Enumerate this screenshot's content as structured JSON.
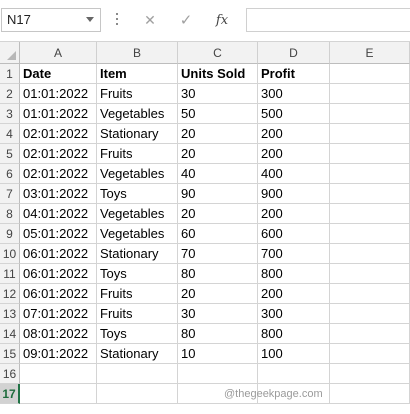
{
  "formula_bar": {
    "name_box": "N17",
    "cancel_glyph": "✕",
    "enter_glyph": "✓",
    "fx_label": "fx",
    "formula": ""
  },
  "columns": [
    "A",
    "B",
    "C",
    "D",
    "E"
  ],
  "rows": [
    "1",
    "2",
    "3",
    "4",
    "5",
    "6",
    "7",
    "8",
    "9",
    "10",
    "11",
    "12",
    "13",
    "14",
    "15",
    "16",
    "17"
  ],
  "active_row": "17",
  "header": [
    "Date",
    "Item",
    "Units Sold",
    "Profit"
  ],
  "data": [
    [
      "01:01:2022",
      "Fruits",
      "30",
      "300"
    ],
    [
      "01:01:2022",
      "Vegetables",
      "50",
      "500"
    ],
    [
      "02:01:2022",
      "Stationary",
      "20",
      "200"
    ],
    [
      "02:01:2022",
      "Fruits",
      "20",
      "200"
    ],
    [
      "02:01:2022",
      "Vegetables",
      "40",
      "400"
    ],
    [
      "03:01:2022",
      "Toys",
      "90",
      "900"
    ],
    [
      "04:01:2022",
      "Vegetables",
      "20",
      "200"
    ],
    [
      "05:01:2022",
      "Vegetables",
      "60",
      "600"
    ],
    [
      "06:01:2022",
      "Stationary",
      "70",
      "700"
    ],
    [
      "06:01:2022",
      "Toys",
      "80",
      "800"
    ],
    [
      "06:01:2022",
      "Fruits",
      "20",
      "200"
    ],
    [
      "07:01:2022",
      "Fruits",
      "30",
      "300"
    ],
    [
      "08:01:2022",
      "Toys",
      "80",
      "800"
    ],
    [
      "09:01:2022",
      "Stationary",
      "10",
      "100"
    ]
  ],
  "watermark": "@thegeekpage.com"
}
